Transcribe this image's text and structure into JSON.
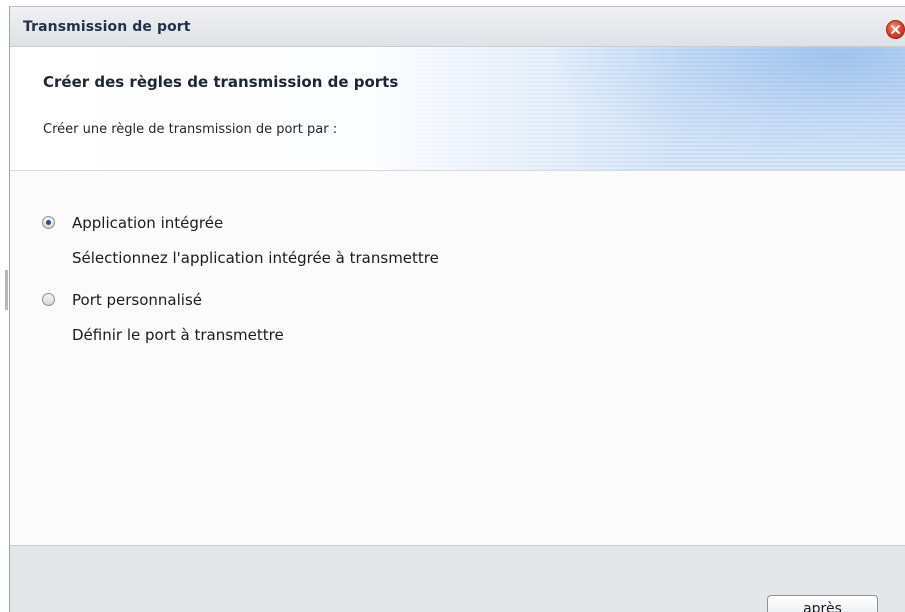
{
  "window": {
    "title": "Transmission de port"
  },
  "header": {
    "title": "Créer des règles de transmission de ports",
    "subtitle": "Créer une règle de transmission de port par :"
  },
  "options": [
    {
      "label": "Application intégrée",
      "description": "Sélectionnez l'application intégrée à transmettre",
      "selected": true
    },
    {
      "label": "Port personnalisé",
      "description": "Définir le port à transmettre",
      "selected": false
    }
  ],
  "footer": {
    "next_label": "après"
  },
  "icons": {
    "close": "close-icon"
  },
  "colors": {
    "title_text": "#21324a",
    "close_red": "#e2452d",
    "radio_dot": "#2d4e8a",
    "header_blue": "#c9ddf4"
  }
}
